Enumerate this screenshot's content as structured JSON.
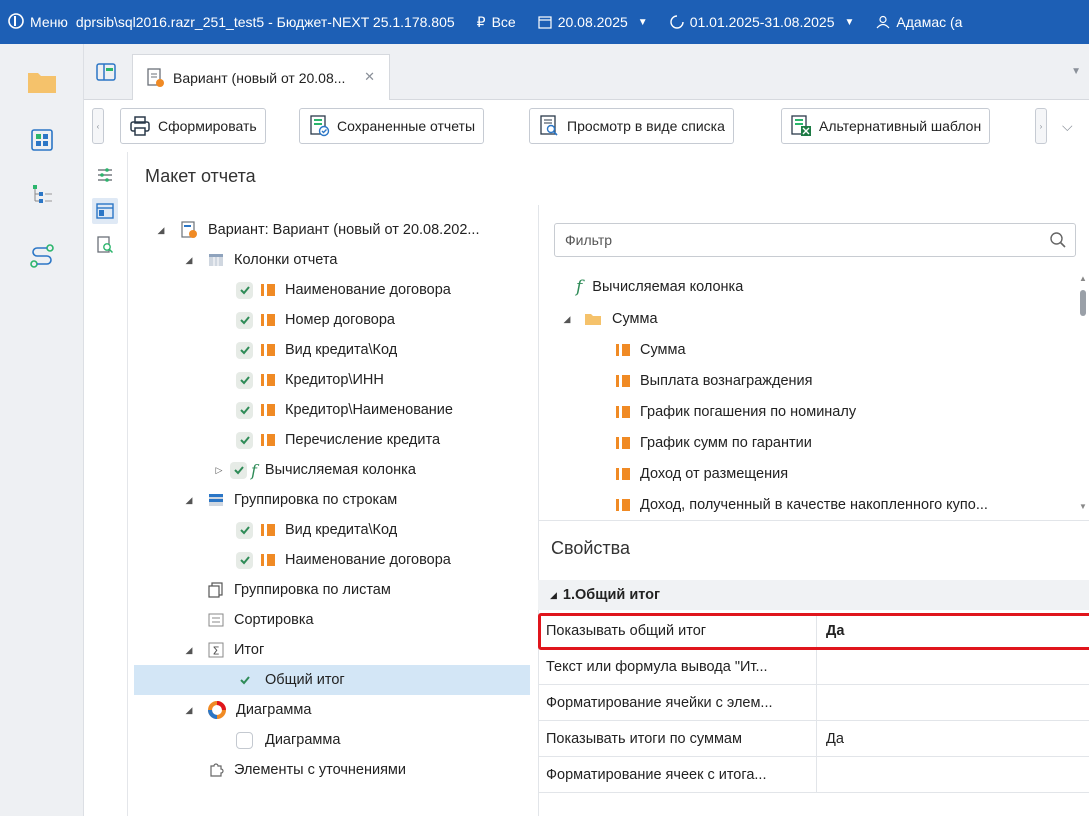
{
  "titlebar": {
    "menu_label": "Меню",
    "app_title": "dprsib\\sql2016.razr_251_test5 - Бюджет-NEXT 25.1.178.805",
    "scope_label": "Все",
    "date": "20.08.2025",
    "period": "01.01.2025-31.08.2025",
    "user": "Адамас (а"
  },
  "tab": {
    "label": "Вариант (новый от 20.08..."
  },
  "toolbar": {
    "generate": "Сформировать",
    "saved_reports": "Сохраненные отчеты",
    "list_view": "Просмотр в виде списка",
    "alt_template": "Альтернативный шаблон"
  },
  "layout_title": "Макет отчета",
  "tree": {
    "root": "Вариант: Вариант (новый от 20.08.202...",
    "columns": "Колонки отчета",
    "col_items": [
      "Наименование договора",
      "Номер договора",
      "Вид кредита\\Код",
      "Кредитор\\ИНН",
      "Кредитор\\Наименование",
      "Перечисление кредита"
    ],
    "calc_column": "Вычисляемая колонка",
    "row_grouping": "Группировка по строкам",
    "row_items": [
      "Вид кредита\\Код",
      "Наименование договора"
    ],
    "sheet_grouping": "Группировка по листам",
    "sorting": "Сортировка",
    "total": "Итог",
    "grand_total": "Общий итог",
    "chart_group": "Диаграмма",
    "chart_item": "Диаграмма",
    "refinements": "Элементы с уточнениями"
  },
  "filter": {
    "placeholder": "Фильтр"
  },
  "fields": {
    "calc_column": "Вычисляемая колонка",
    "sum_folder": "Сумма",
    "items": [
      "Сумма",
      "Выплата вознаграждения",
      "График погашения по номиналу",
      "График сумм по гарантии",
      "Доход от размещения",
      "Доход, полученный в качестве накопленного купо..."
    ]
  },
  "properties": {
    "title": "Свойства",
    "group": "1.Общий итог",
    "rows": [
      {
        "name": "Показывать общий итог",
        "value": "Да"
      },
      {
        "name": "Текст или формула вывода \"Ит...",
        "value": ""
      },
      {
        "name": "Форматирование ячейки с элем...",
        "value": ""
      },
      {
        "name": "Показывать итоги по суммам",
        "value": "Да"
      },
      {
        "name": "Форматирование ячеек с итога...",
        "value": ""
      }
    ]
  },
  "colors": {
    "titlebar": "#1d5fb5",
    "accent_orange": "#f08a24",
    "check_green": "#2e8b57",
    "highlight_red": "#e0151c",
    "selection": "#d3e6f6"
  }
}
